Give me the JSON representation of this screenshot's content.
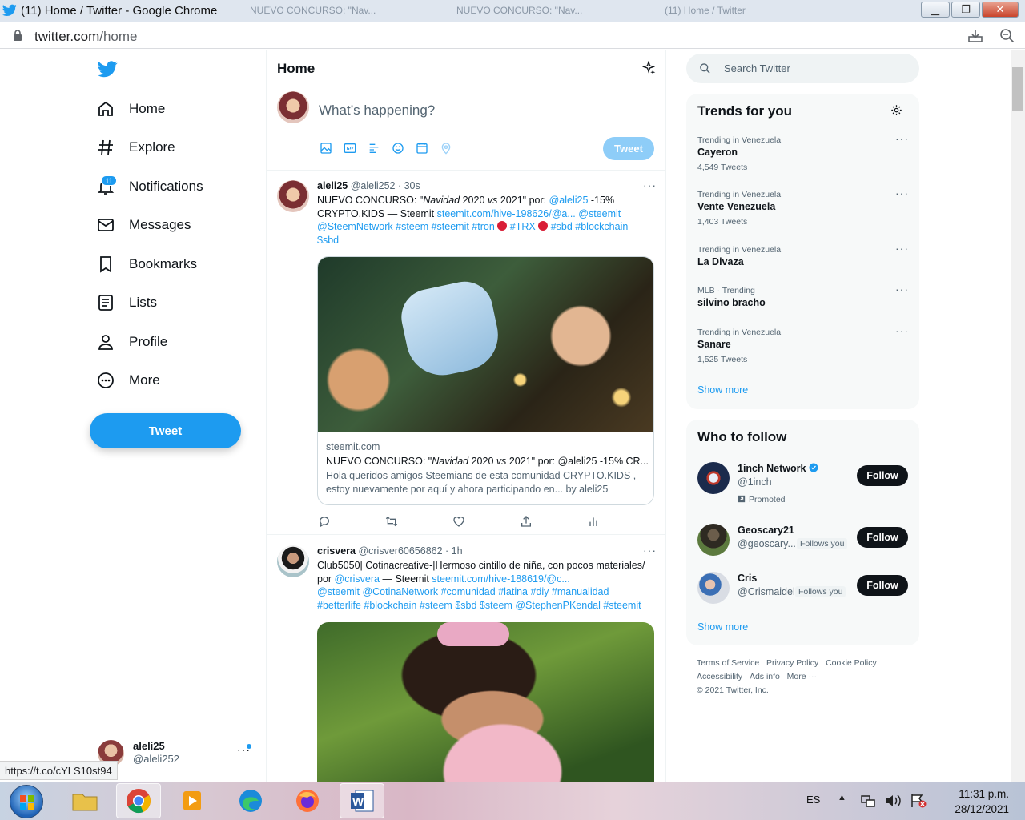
{
  "browser": {
    "window_title": "(11) Home / Twitter - Google Chrome",
    "ghost_tabs": [
      "NUEVO CONCURSO: \"Nav...",
      "NUEVO CONCURSO: \"Nav...",
      "(11) Home / Twitter"
    ],
    "url_domain": "twitter.com",
    "url_path": "/home",
    "status_link": "https://t.co/cYLS10st94"
  },
  "nav": {
    "items": [
      {
        "label": "Home",
        "icon": "home-icon"
      },
      {
        "label": "Explore",
        "icon": "hashtag-icon"
      },
      {
        "label": "Notifications",
        "icon": "bell-icon",
        "badge": "11"
      },
      {
        "label": "Messages",
        "icon": "mail-icon"
      },
      {
        "label": "Bookmarks",
        "icon": "bookmark-icon"
      },
      {
        "label": "Lists",
        "icon": "list-icon"
      },
      {
        "label": "Profile",
        "icon": "user-icon"
      },
      {
        "label": "More",
        "icon": "more-circle-icon"
      }
    ],
    "tweet_button": "Tweet",
    "account": {
      "name": "aleli25",
      "handle": "@aleli252"
    }
  },
  "timeline": {
    "title": "Home",
    "composer_placeholder": "What’s happening?",
    "composer_tweet_button": "Tweet",
    "tweets": [
      {
        "name": "aleli25",
        "handle": "@aleli252",
        "time": "30s",
        "line1_a": "NUEVO CONCURSO: \"",
        "line1_italic": "Navidad",
        "line1_b": " 2020 ",
        "line1_vs": "vs",
        "line1_c": " 2021\" por: ",
        "mention1": "@aleli25",
        "line1_d": " -15%",
        "line2_a": "CRYPTO.KIDS — Steemit ",
        "link1": "steemit.com/hive-198626/@a...",
        "mention2": "@steemit",
        "line3_a": "@SteemNetwork #steem #steemit #tron",
        "line3_b": "#TRX",
        "line3_c": "#sbd #blockchain",
        "line4": "$sbd",
        "card": {
          "domain": "steemit.com",
          "title_a": "NUEVO CONCURSO: \"",
          "title_italic": "Navidad",
          "title_b": " 2020 ",
          "title_vs": "vs",
          "title_c": " 2021\" por: @aleli25 -15% CR...",
          "desc1": "Hola queridos amigos Steemians de esta comunidad CRYPTO.KIDS ,",
          "desc2": "estoy nuevamente por aquí y ahora participando en... by aleli25"
        }
      },
      {
        "name": "crisvera",
        "handle": "@crisver60656862",
        "time": "1h",
        "line1": "Club5050| Cotinacreative-|Hermoso cintillo de niña, con pocos materiales/",
        "line2_a": "por ",
        "mention1": "@crisvera",
        "line2_b": " — Steemit ",
        "link1": "steemit.com/hive-188619/@c...",
        "line3": "@steemit @CotinaNetwork  #comunidad #latina #diy #manualidad",
        "line4": "#betterlife #blockchain #steem $sbd $steem @StephenPKendal #steemit"
      }
    ]
  },
  "sidebar": {
    "search_placeholder": "Search Twitter",
    "trends_title": "Trends for you",
    "trends": [
      {
        "context": "Trending in Venezuela",
        "name": "Cayeron",
        "count": "4,549 Tweets"
      },
      {
        "context": "Trending in Venezuela",
        "name": "Vente Venezuela",
        "count": "1,403 Tweets"
      },
      {
        "context": "Trending in Venezuela",
        "name": "La Divaza",
        "count": ""
      },
      {
        "context": "MLB · Trending",
        "name": "silvino bracho",
        "count": ""
      },
      {
        "context": "Trending in Venezuela",
        "name": "Sanare",
        "count": "1,525 Tweets"
      }
    ],
    "trends_show_more": "Show more",
    "who_title": "Who to follow",
    "who": [
      {
        "name": "1inch Network",
        "handle": "@1inch",
        "note": "Promoted",
        "follows_you": "",
        "button": "Follow"
      },
      {
        "name": "Geoscary21",
        "handle": "@geoscary...",
        "note": "",
        "follows_you": "Follows you",
        "button": "Follow"
      },
      {
        "name": "Cris",
        "handle": "@Crismaidel",
        "note": "",
        "follows_you": "Follows you",
        "button": "Follow"
      }
    ],
    "who_show_more": "Show more",
    "footer": {
      "line1": [
        "Terms of Service",
        "Privacy Policy",
        "Cookie Policy"
      ],
      "line2": [
        "Accessibility",
        "Ads info",
        "More ···"
      ],
      "copyright": "© 2021 Twitter, Inc."
    }
  },
  "taskbar": {
    "lang": "ES",
    "time": "11:31 p.m.",
    "date": "28/12/2021"
  }
}
